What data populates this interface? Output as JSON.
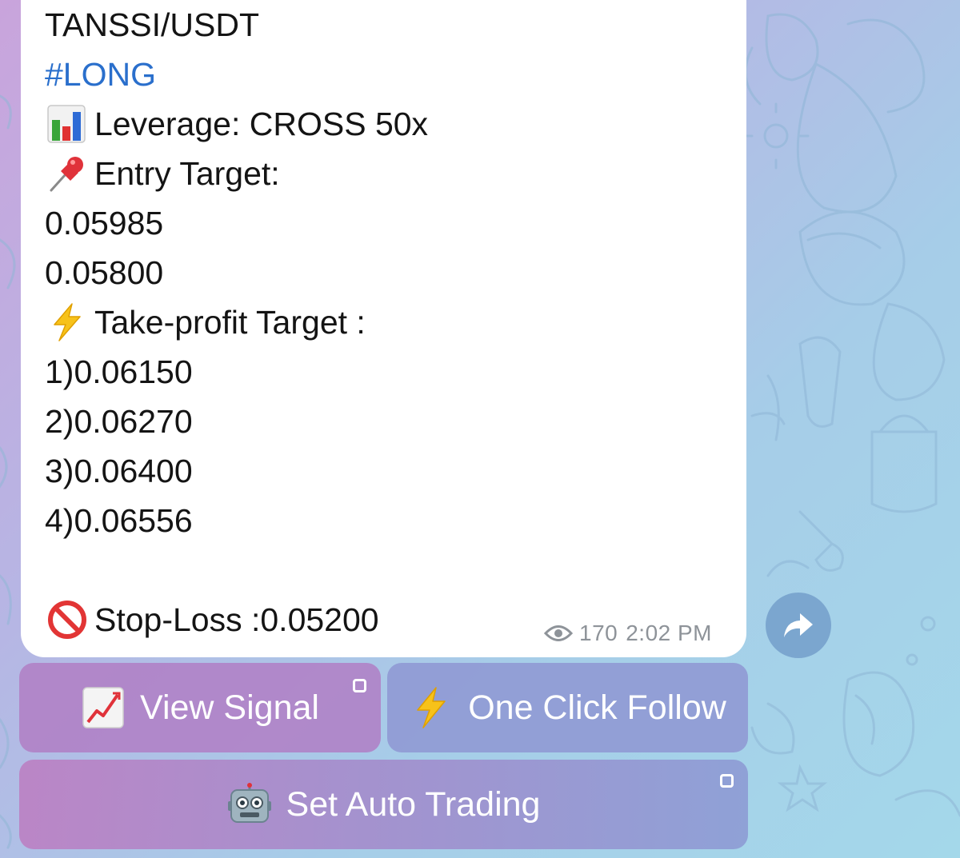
{
  "message": {
    "pair": "TANSSI/USDT",
    "hashtag": "#LONG",
    "leverage": "Leverage: CROSS 50x",
    "entry_label": "Entry Target:",
    "entry_1": "0.05985",
    "entry_2": "0.05800",
    "tp_label": "Take-profit Target :",
    "tp_1": "1)0.06150",
    "tp_2": "2)0.06270",
    "tp_3": "3)0.06400",
    "tp_4": "4)0.06556",
    "stop_loss": "Stop-Loss :0.05200",
    "views": "170",
    "time": "2:02 PM"
  },
  "icons": {
    "leverage": "bar-chart-emoji",
    "entry": "pushpin-emoji",
    "tp": "lightning-emoji",
    "stop": "no-entry-emoji",
    "views": "eye-icon",
    "share": "share-arrow-icon",
    "view_signal": "chart-increasing-emoji",
    "follow": "lightning-emoji",
    "auto": "robot-emoji"
  },
  "keyboard": {
    "view_signal": "View Signal",
    "one_click_follow": "One Click Follow",
    "set_auto_trading": "Set Auto Trading"
  },
  "colors": {
    "hashtag": "#2a6fcc",
    "share_button": "#7ba6cf"
  }
}
